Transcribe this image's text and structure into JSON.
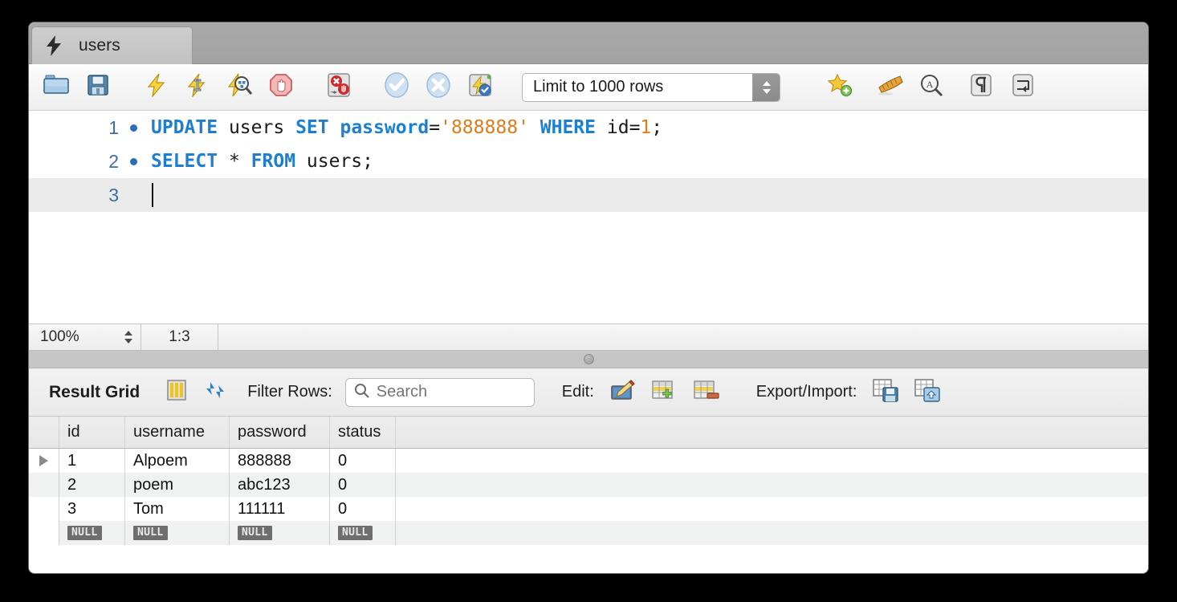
{
  "window": {
    "tab": {
      "label": "users",
      "icon": "lightning-bolt-icon"
    }
  },
  "sql_toolbar": {
    "buttons": [
      {
        "name": "open-sql-file-button",
        "icon": "folder-icon",
        "tooltip": "Open a SQL script file"
      },
      {
        "name": "save-sql-file-button",
        "icon": "floppy-disk-icon",
        "tooltip": "Save script to file"
      },
      {
        "name": "execute-statement-button",
        "icon": "lightning-bolt-icon",
        "tooltip": "Execute the selected portion of the script"
      },
      {
        "name": "execute-current-statement-button",
        "icon": "lightning-bolt-cursor-icon",
        "tooltip": "Execute the statement under the keyboard cursor"
      },
      {
        "name": "explain-statement-button",
        "icon": "lightning-bolt-magnifier-icon",
        "tooltip": "Execute Explain for the statement under the cursor"
      },
      {
        "name": "stop-execution-button",
        "icon": "stop-hand-icon",
        "tooltip": "Stop the query being executed"
      },
      {
        "name": "toggle-stop-on-error-button",
        "icon": "stop-on-error-icon",
        "tooltip": "Toggle whether execution should stop on errors"
      },
      {
        "name": "commit-button",
        "icon": "commit-check-icon",
        "tooltip": "Commit the current transaction"
      },
      {
        "name": "rollback-button",
        "icon": "rollback-cross-icon",
        "tooltip": "Rollback the current transaction"
      },
      {
        "name": "toggle-autocommit-button",
        "icon": "autocommit-icon",
        "tooltip": "Toggle autocommit mode"
      },
      {
        "name": "new-snippet-button",
        "icon": "star-plus-icon",
        "tooltip": "Save current statement to snippets list"
      },
      {
        "name": "beautify-query-button",
        "icon": "broom-icon",
        "tooltip": "Beautify/reformat the SQL script"
      },
      {
        "name": "find-button",
        "icon": "magnifier-a-icon",
        "tooltip": "Show the Find panel"
      },
      {
        "name": "toggle-invisible-chars-button",
        "icon": "pilcrow-icon",
        "tooltip": "Toggle invisible characters"
      },
      {
        "name": "toggle-wrapping-button",
        "icon": "wrap-lines-icon",
        "tooltip": "Toggle wrapping of long lines"
      }
    ],
    "limit_select": {
      "value": "Limit to 1000 rows"
    }
  },
  "editor": {
    "lines": [
      {
        "number": "1",
        "has_breakpoint": true,
        "tokens": [
          {
            "t": "UPDATE",
            "c": "kw"
          },
          {
            "t": " ",
            "c": "op"
          },
          {
            "t": "users",
            "c": "op"
          },
          {
            "t": " ",
            "c": "op"
          },
          {
            "t": "SET",
            "c": "kw"
          },
          {
            "t": " ",
            "c": "op"
          },
          {
            "t": "password",
            "c": "kw"
          },
          {
            "t": "=",
            "c": "op"
          },
          {
            "t": "'888888'",
            "c": "str"
          },
          {
            "t": " ",
            "c": "op"
          },
          {
            "t": "WHERE",
            "c": "kw"
          },
          {
            "t": " ",
            "c": "op"
          },
          {
            "t": "id",
            "c": "op"
          },
          {
            "t": "=",
            "c": "op"
          },
          {
            "t": "1",
            "c": "num"
          },
          {
            "t": ";",
            "c": "op"
          }
        ]
      },
      {
        "number": "2",
        "has_breakpoint": true,
        "tokens": [
          {
            "t": "SELECT",
            "c": "kw"
          },
          {
            "t": " ",
            "c": "op"
          },
          {
            "t": "*",
            "c": "op"
          },
          {
            "t": " ",
            "c": "op"
          },
          {
            "t": "FROM",
            "c": "kw"
          },
          {
            "t": " ",
            "c": "op"
          },
          {
            "t": "users",
            "c": "op"
          },
          {
            "t": ";",
            "c": "op"
          }
        ]
      },
      {
        "number": "3",
        "has_breakpoint": false,
        "active": true,
        "tokens": []
      }
    ]
  },
  "editor_status": {
    "zoom": "100%",
    "cursor_position": "1:3"
  },
  "result_grid": {
    "title": "Result Grid",
    "toggle_grid_icon": "grid-columns-icon",
    "refresh_icon": "refresh-arrows-icon",
    "filter_label": "Filter Rows:",
    "search_placeholder": "Search",
    "search_value": "",
    "edit_label": "Edit:",
    "edit_buttons": [
      {
        "name": "edit-row-button",
        "icon": "pencil-edit-icon"
      },
      {
        "name": "insert-row-button",
        "icon": "table-plus-icon"
      },
      {
        "name": "delete-row-button",
        "icon": "table-minus-icon"
      }
    ],
    "export_label": "Export/Import:",
    "export_buttons": [
      {
        "name": "export-recordset-button",
        "icon": "table-save-icon"
      },
      {
        "name": "import-recordset-button",
        "icon": "table-import-icon"
      }
    ],
    "columns": [
      "id",
      "username",
      "password",
      "status"
    ],
    "rows": [
      {
        "selected": true,
        "cells": [
          "1",
          "Alpoem",
          "888888",
          "0"
        ]
      },
      {
        "selected": false,
        "cells": [
          "2",
          "poem",
          "abc123",
          "0"
        ]
      },
      {
        "selected": false,
        "cells": [
          "3",
          "Tom",
          "111111",
          "0"
        ]
      }
    ],
    "null_row": [
      "NULL",
      "NULL",
      "NULL",
      "NULL"
    ]
  },
  "colors": {
    "keyword": "#1d7fd1",
    "string": "#e07c18",
    "number": "#e07c18",
    "line_number": "#3b6ea5",
    "breakpoint": "#2a6ebb",
    "null_badge": "#6e6e6e"
  }
}
